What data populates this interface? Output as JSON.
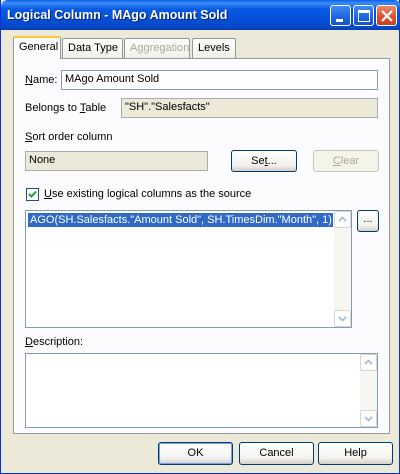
{
  "window": {
    "title": "Logical Column - MAgo Amount Sold"
  },
  "tabs": [
    {
      "label": "General",
      "active": true,
      "enabled": true
    },
    {
      "label": "Data Type",
      "active": false,
      "enabled": true
    },
    {
      "label": "Aggregation",
      "active": false,
      "enabled": false
    },
    {
      "label": "Levels",
      "active": false,
      "enabled": true
    }
  ],
  "general": {
    "name_label": "Name:",
    "name_value": "MAgo Amount Sold",
    "belongs_label": "Belongs to Table",
    "belongs_value": "\"SH\".\"Salesfacts\"",
    "sort_label": "Sort order column",
    "sort_value": "None",
    "set_button": "Set...",
    "clear_button": "Clear",
    "use_existing_label": "Use existing logical columns as the source",
    "use_existing_checked": true,
    "expression": "AGO(SH.Salesfacts.\"Amount Sold\", SH.TimesDim.\"Month\", 1)",
    "expr_button": "...",
    "description_label": "Description:",
    "description_value": ""
  },
  "buttons": {
    "ok": "OK",
    "cancel": "Cancel",
    "help": "Help"
  },
  "colors": {
    "titlebar": "#0a5ae4",
    "selection": "#316ac5",
    "face": "#ece9d8"
  }
}
